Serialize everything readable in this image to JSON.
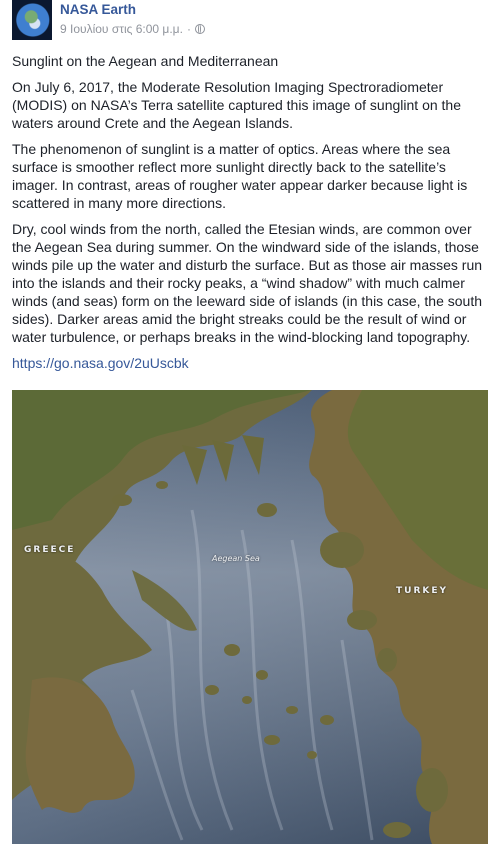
{
  "post": {
    "author": "NASA Earth",
    "timestamp": "9 Ιουλίου στις 6:00 μ.μ.",
    "separator": "·",
    "privacy_icon": "globe-icon",
    "title": "Sunglint on the Aegean and Mediterranean",
    "paragraphs": [
      "On July 6, 2017, the Moderate Resolution Imaging Spectroradiometer (MODIS) on NASA’s Terra satellite captured this image of sunglint on the waters around Crete and the Aegean Islands.",
      "The phenomenon of sunglint is a matter of optics. Areas where the sea surface is smoother reflect more sunlight directly back to the satellite’s imager. In contrast, areas of rougher water appear darker because light is scattered in many more directions.",
      "Dry, cool winds from the north, called the Etesian winds, are common over the Aegean Sea during summer. On the windward side of the islands, those winds pile up the water and disturb the surface. But as those air masses run into the islands and their rocky peaks, a “wind shadow” with much calmer winds (and seas) form on the leeward side of islands (in this case, the south sides). Darker areas amid the bright streaks could be the result of wind or water turbulence, or perhaps breaks in the wind-blocking land topography."
    ],
    "link": "https://go.nasa.gov/2uUscbk",
    "image": {
      "label_greece": "GREECE",
      "label_turkey": "TURKEY",
      "label_sea": "Aegean Sea"
    }
  },
  "colors": {
    "link_blue": "#365899",
    "meta_gray": "#90949c",
    "text": "#1d2129"
  }
}
